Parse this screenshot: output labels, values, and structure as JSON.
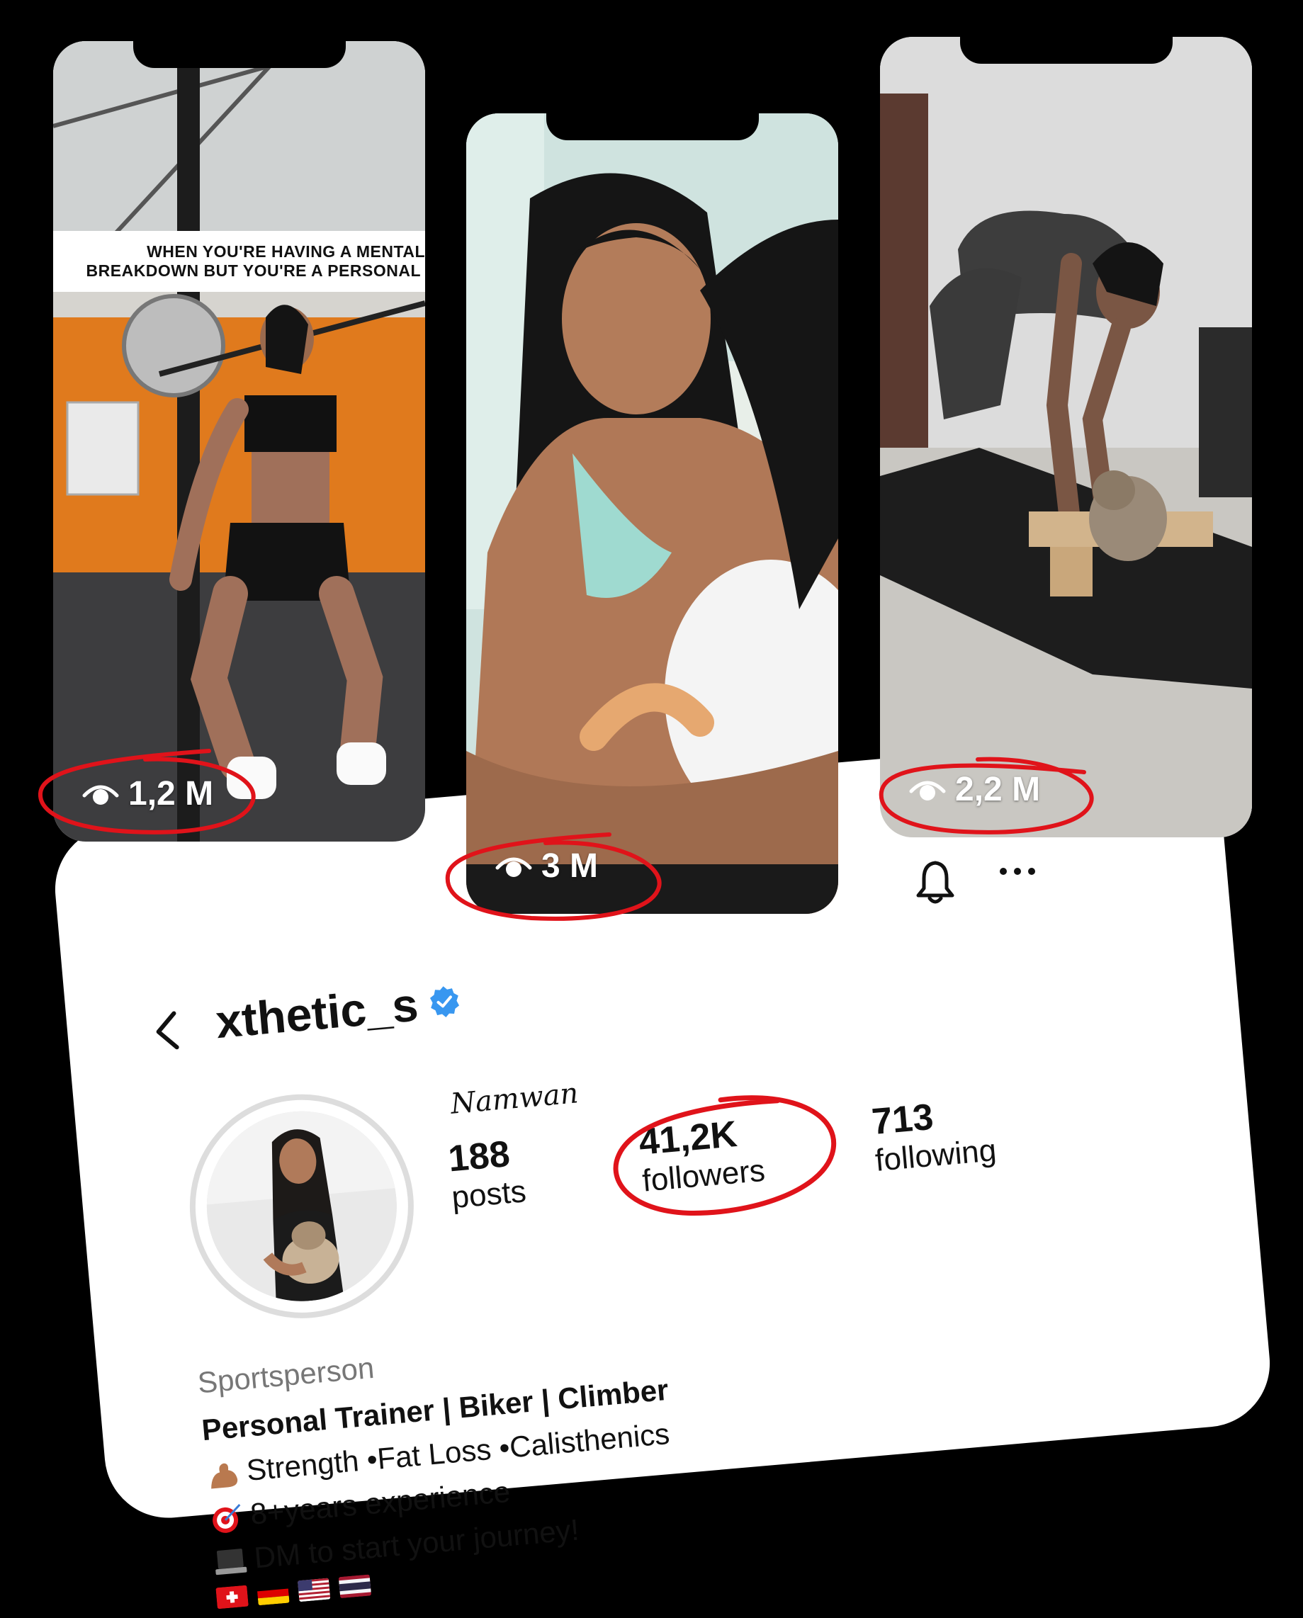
{
  "reels": [
    {
      "caption_line1": "WHEN YOU'RE HAVING A MENTAL",
      "caption_line2": "BREAKDOWN BUT YOU'RE A PERSONAL",
      "views": "1,2 M"
    },
    {
      "views": "3 M"
    },
    {
      "views": "2,2 M"
    }
  ],
  "profile": {
    "username": "xthetic_s",
    "display_name": "Namwan",
    "posts_count": "188",
    "posts_label": "posts",
    "followers_count": "41,2K",
    "followers_label": "followers",
    "following_count": "713",
    "following_label": "following",
    "category": "Sportsperson",
    "bio_line1": "Personal Trainer | Biker | Climber",
    "bio_line2": "Strength •Fat Loss •Calisthenics",
    "bio_line3": "8+years experience",
    "bio_line4": "DM to start your journey!"
  },
  "colors": {
    "highlight_red": "#e0131a",
    "verified_blue": "#3897f0",
    "background": "#000000"
  }
}
